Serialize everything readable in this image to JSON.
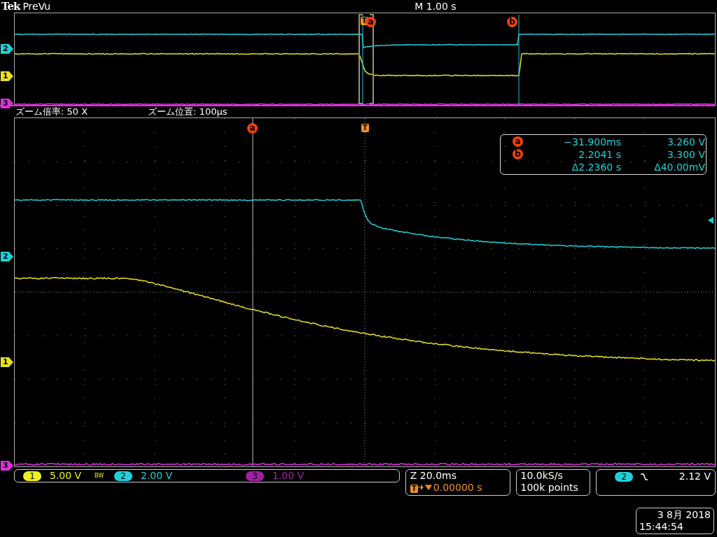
{
  "header": {
    "brand": "Tek",
    "mode": "PreVu",
    "timebase": "M 1.00 s"
  },
  "overview": {
    "trigger_label": "T",
    "cursors": [
      "a",
      "b"
    ],
    "channel_markers": [
      {
        "label": "2",
        "color": "#20d0d8"
      },
      {
        "label": "1",
        "color": "#e8e020"
      },
      {
        "label": "3",
        "color": "#e030e0"
      }
    ]
  },
  "zoom_info": {
    "factor": "ズーム倍率: 50 X",
    "position": "ズーム位置: 100µs"
  },
  "main": {
    "trigger_label": "T",
    "cursor_label": "a",
    "channel_markers": [
      {
        "label": "2",
        "color": "#20d0d8"
      },
      {
        "label": "1",
        "color": "#e8e020"
      },
      {
        "label": "3",
        "color": "#e030e0"
      }
    ],
    "readout": {
      "rows": [
        {
          "cursor": "a",
          "time": "−31.900ms",
          "value": "3.260 V"
        },
        {
          "cursor": "b",
          "time": "2.2041 s",
          "value": "3.300 V"
        }
      ],
      "delta": {
        "time": "Δ2.2360 s",
        "value": "Δ40.00mV"
      }
    }
  },
  "status": {
    "channels": [
      {
        "number": "1",
        "scale": "5.00 V",
        "color": "#f0f020",
        "bw": "BW"
      },
      {
        "number": "2",
        "scale": "2.00 V",
        "color": "#20d0d8"
      },
      {
        "number": "3",
        "scale": "1.00 V",
        "color": "#a020a0"
      }
    ],
    "horizontal": {
      "zoom": "Z 20.0ms",
      "trigger_icon": "T",
      "position": "0.00000 s"
    },
    "acquisition": {
      "rate": "10.0kS/s",
      "points": "100k points"
    },
    "trigger": {
      "channel": "2",
      "color": "#20d0d8",
      "level": "2.12 V"
    }
  },
  "date": {
    "date": "3 8月 2018",
    "time": "15:44:54"
  }
}
